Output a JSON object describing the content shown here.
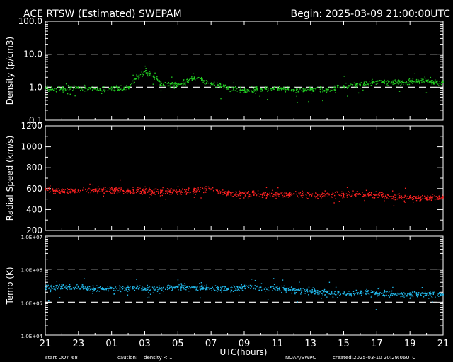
{
  "header": {
    "title": "ACE RTSW (Estimated) SWEPAM",
    "begin": "Begin: 2025-03-09 21:00:00UTC"
  },
  "footer": {
    "start_doy": "start DOY:  68",
    "caution_prefix": "caution:",
    "caution_text": "density < 1",
    "source": "NOAA/SWPC",
    "created": "created:2025-03-10 20:29:06UTC",
    "xlabel": "UTC(hours)"
  },
  "colors": {
    "background": "#000000",
    "axes": "#ffffff",
    "density": "#22cc22",
    "speed": "#ff2222",
    "temp": "#22bbee",
    "caution": "#ffff00"
  },
  "chart_data": [
    {
      "type": "scatter",
      "ylabel": "Density (p/cm3)",
      "yscale": "log",
      "ylim": [
        0.1,
        100
      ],
      "yticks": [
        "0.1",
        "1.0",
        "10.0",
        "100.0"
      ],
      "reference_lines": [
        1,
        10
      ],
      "x_hours_range": [
        0,
        24
      ],
      "series": [
        {
          "values": [
            {
              "x": 0,
              "y": 0.95
            },
            {
              "x": 1,
              "y": 0.9
            },
            {
              "x": 2,
              "y": 1.0
            },
            {
              "x": 3,
              "y": 0.9
            },
            {
              "x": 4,
              "y": 0.95
            },
            {
              "x": 5,
              "y": 1.0
            },
            {
              "x": 6,
              "y": 3.0
            },
            {
              "x": 7,
              "y": 1.3
            },
            {
              "x": 8,
              "y": 1.2
            },
            {
              "x": 9,
              "y": 2.0
            },
            {
              "x": 10,
              "y": 1.3
            },
            {
              "x": 11,
              "y": 1.0
            },
            {
              "x": 12,
              "y": 0.8
            },
            {
              "x": 13,
              "y": 0.9
            },
            {
              "x": 14,
              "y": 0.95
            },
            {
              "x": 15,
              "y": 0.8
            },
            {
              "x": 16,
              "y": 0.9
            },
            {
              "x": 17,
              "y": 0.85
            },
            {
              "x": 18,
              "y": 1.05
            },
            {
              "x": 19,
              "y": 1.2
            },
            {
              "x": 20,
              "y": 1.5
            },
            {
              "x": 21,
              "y": 1.4
            },
            {
              "x": 22,
              "y": 1.5
            },
            {
              "x": 23,
              "y": 1.6
            },
            {
              "x": 24,
              "y": 1.4
            }
          ]
        }
      ]
    },
    {
      "type": "scatter",
      "ylabel": "Radial Speed (km/s)",
      "yscale": "linear",
      "ylim": [
        200,
        1200
      ],
      "yticks": [
        "200",
        "400",
        "600",
        "800",
        "1000",
        "1200"
      ],
      "x_hours_range": [
        0,
        24
      ],
      "series": [
        {
          "values": [
            {
              "x": 0,
              "y": 600
            },
            {
              "x": 1,
              "y": 585
            },
            {
              "x": 2,
              "y": 580
            },
            {
              "x": 3,
              "y": 590
            },
            {
              "x": 4,
              "y": 595
            },
            {
              "x": 5,
              "y": 580
            },
            {
              "x": 6,
              "y": 575
            },
            {
              "x": 7,
              "y": 580
            },
            {
              "x": 8,
              "y": 570
            },
            {
              "x": 9,
              "y": 585
            },
            {
              "x": 10,
              "y": 595
            },
            {
              "x": 11,
              "y": 560
            },
            {
              "x": 12,
              "y": 555
            },
            {
              "x": 13,
              "y": 545
            },
            {
              "x": 14,
              "y": 550
            },
            {
              "x": 15,
              "y": 550
            },
            {
              "x": 16,
              "y": 545
            },
            {
              "x": 17,
              "y": 550
            },
            {
              "x": 18,
              "y": 545
            },
            {
              "x": 19,
              "y": 545
            },
            {
              "x": 20,
              "y": 540
            },
            {
              "x": 21,
              "y": 525
            },
            {
              "x": 22,
              "y": 515
            },
            {
              "x": 23,
              "y": 515
            },
            {
              "x": 24,
              "y": 520
            }
          ]
        }
      ]
    },
    {
      "type": "scatter",
      "ylabel": "Temp (K)",
      "yscale": "log",
      "ylim": [
        10000,
        10000000
      ],
      "yticks": [
        "1.0E+04",
        "1.0E+05",
        "1.0E+06",
        "1.0E+07"
      ],
      "reference_lines": [
        100000,
        1000000
      ],
      "x_hours_range": [
        0,
        24
      ],
      "series": [
        {
          "values": [
            {
              "x": 0,
              "y": 270000
            },
            {
              "x": 1,
              "y": 300000
            },
            {
              "x": 2,
              "y": 290000
            },
            {
              "x": 3,
              "y": 260000
            },
            {
              "x": 4,
              "y": 270000
            },
            {
              "x": 5,
              "y": 280000
            },
            {
              "x": 6,
              "y": 260000
            },
            {
              "x": 7,
              "y": 270000
            },
            {
              "x": 8,
              "y": 300000
            },
            {
              "x": 9,
              "y": 280000
            },
            {
              "x": 10,
              "y": 260000
            },
            {
              "x": 11,
              "y": 250000
            },
            {
              "x": 12,
              "y": 300000
            },
            {
              "x": 13,
              "y": 280000
            },
            {
              "x": 14,
              "y": 260000
            },
            {
              "x": 15,
              "y": 240000
            },
            {
              "x": 16,
              "y": 220000
            },
            {
              "x": 17,
              "y": 200000
            },
            {
              "x": 18,
              "y": 180000
            },
            {
              "x": 19,
              "y": 200000
            },
            {
              "x": 20,
              "y": 190000
            },
            {
              "x": 21,
              "y": 180000
            },
            {
              "x": 22,
              "y": 170000
            },
            {
              "x": 23,
              "y": 180000
            },
            {
              "x": 24,
              "y": 170000
            }
          ]
        }
      ]
    }
  ],
  "xticks": [
    "21",
    "23",
    "01",
    "03",
    "05",
    "07",
    "09",
    "11",
    "13",
    "15",
    "17",
    "19",
    "21"
  ]
}
